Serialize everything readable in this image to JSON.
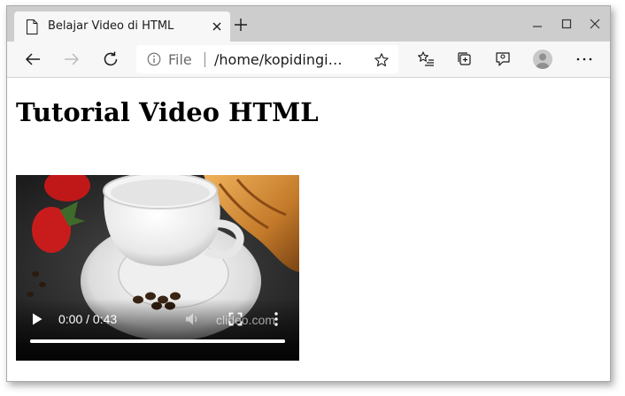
{
  "browser": {
    "tab": {
      "title": "Belajar Video di HTML",
      "icon": "page-icon"
    },
    "address": {
      "scheme": "File",
      "url": "/home/kopidingi…"
    },
    "accent": "#0078d7"
  },
  "page": {
    "heading": "Tutorial Video HTML",
    "video": {
      "time": "0:00 / 0:43",
      "current_time": "0:00",
      "duration": "0:43",
      "progress": 1.0,
      "watermark": "clideo.com"
    }
  }
}
